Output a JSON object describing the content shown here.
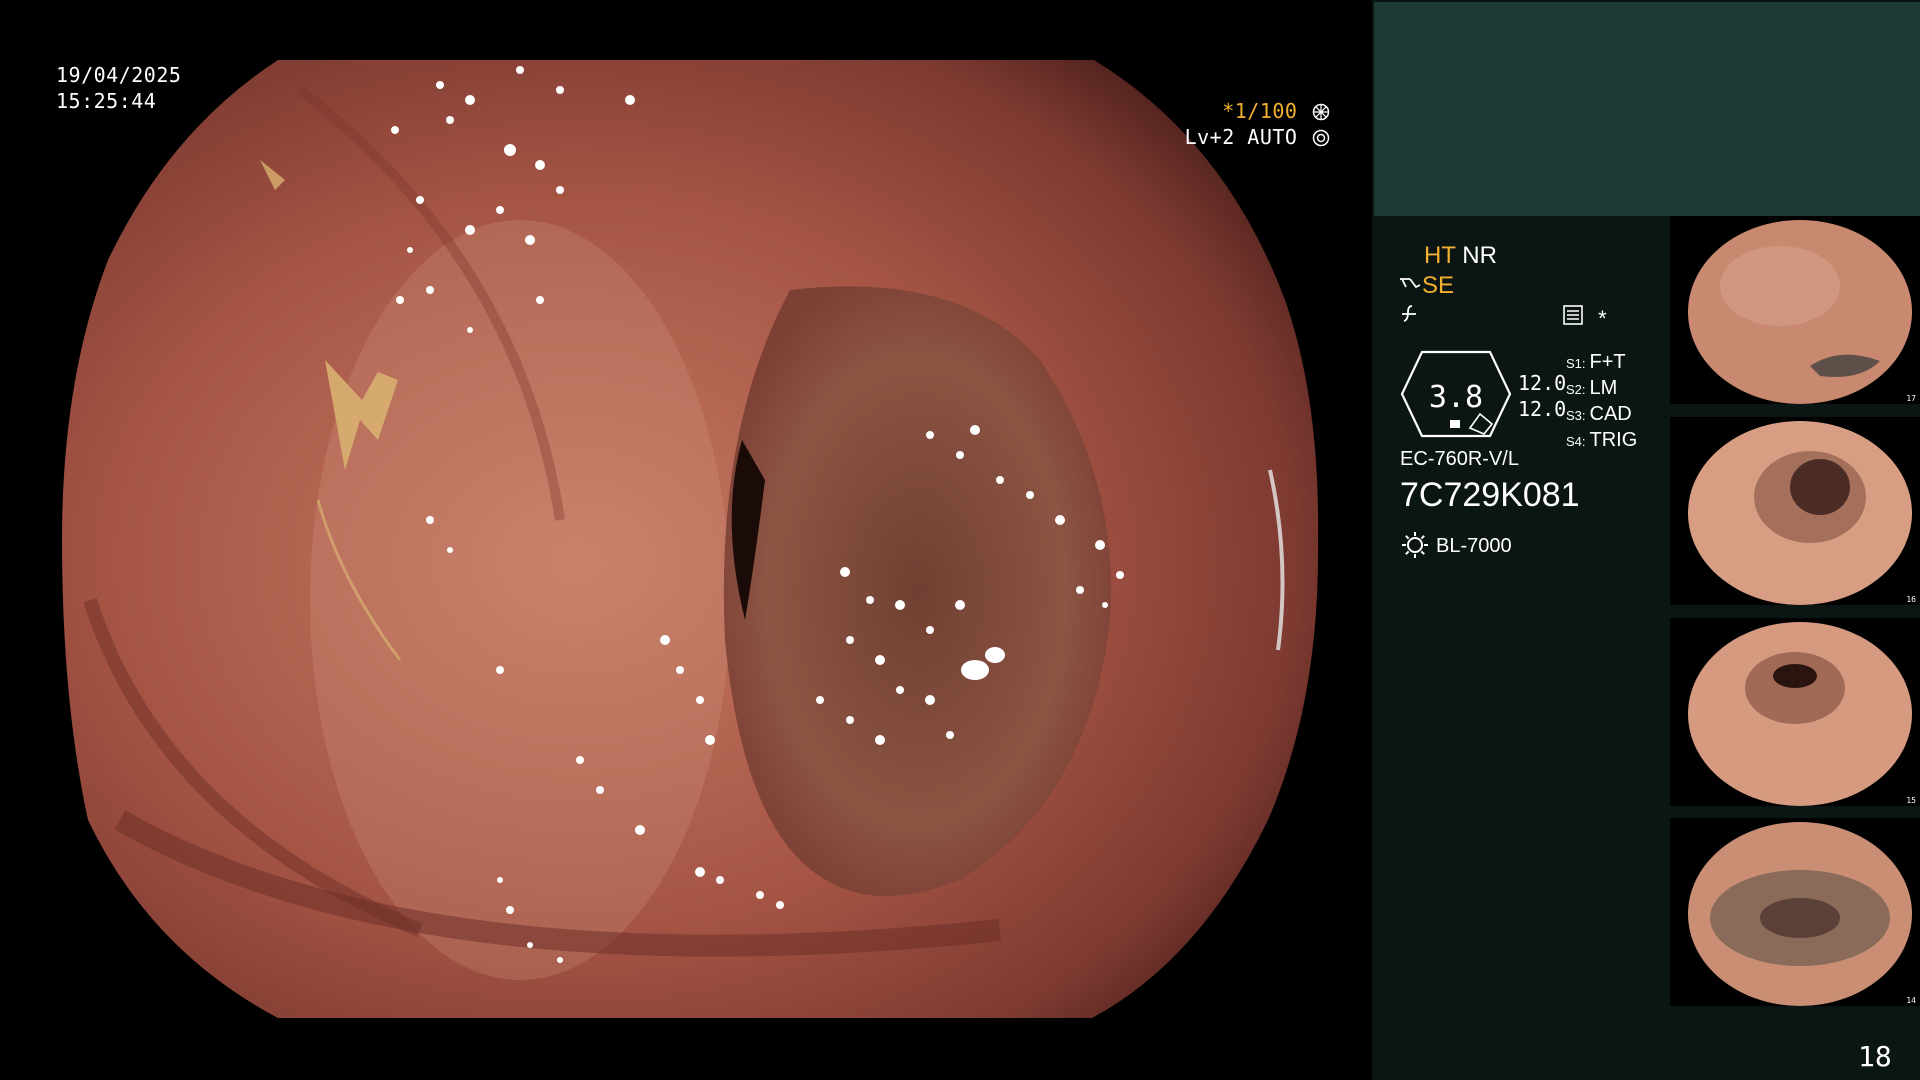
{
  "overlay": {
    "date": "19/04/2025",
    "time": "15:25:44",
    "exposure_prefix": "*",
    "exposure_shutter": "1/100",
    "exposure_icon": "aperture-icon",
    "level_text": "Lv+2 AUTO",
    "level_icon": "auto-iris-icon"
  },
  "settings": {
    "ht_label": "HT",
    "nr_label": "NR",
    "se_label": "SE",
    "se_icon": "structure-enhance-icon",
    "f_icon": "filter-icon",
    "menu_icon": "menu-icon",
    "star_label": "*",
    "gauge_value": "3.8",
    "gauge_side_1": "12.0",
    "gauge_side_2": "12.0"
  },
  "switches": [
    {
      "key": "S1:",
      "value": "F+T"
    },
    {
      "key": "S2:",
      "value": "LM"
    },
    {
      "key": "S3:",
      "value": "CAD"
    },
    {
      "key": "S4:",
      "value": "TRIG"
    }
  ],
  "scope": {
    "model": "EC-760R-V/L",
    "serial": "7C729K081",
    "light_source": "BL-7000",
    "light_icon": "light-source-icon"
  },
  "thumbnails": [
    {
      "index": "17"
    },
    {
      "index": "16"
    },
    {
      "index": "15"
    },
    {
      "index": "14"
    }
  ],
  "page_number": "18",
  "colors": {
    "accent": "#f0b030",
    "panel_top": "#1d3a36",
    "panel_body": "#0b1614"
  }
}
